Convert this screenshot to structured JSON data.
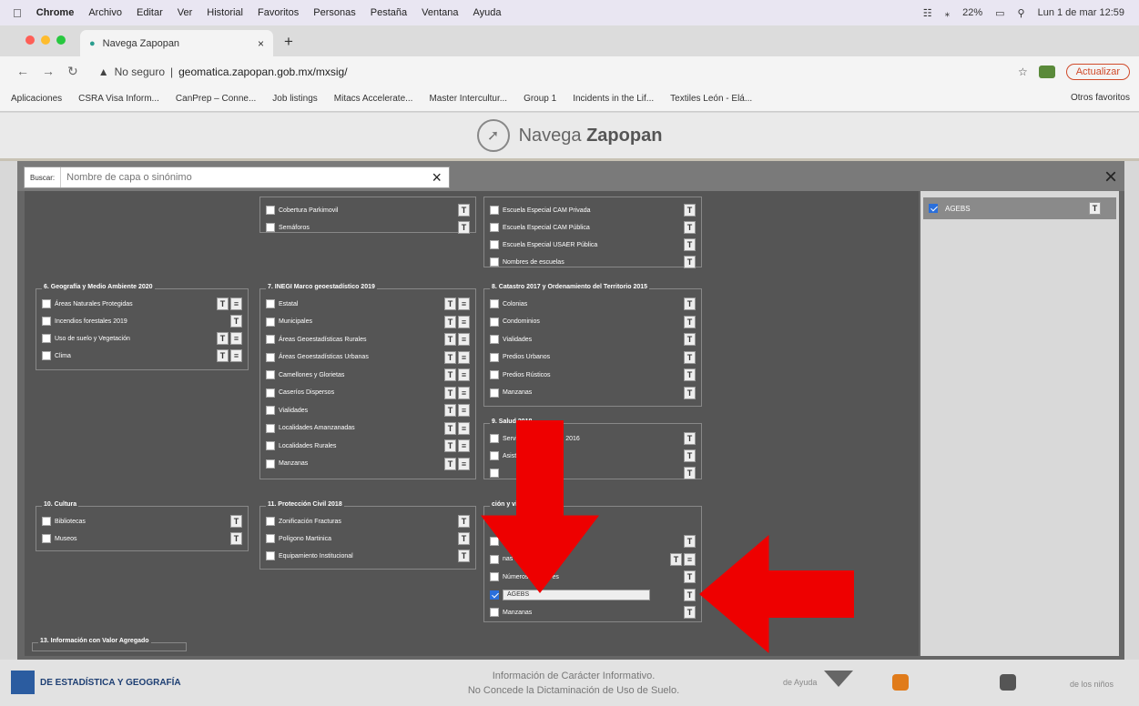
{
  "menubar": {
    "apple": "",
    "app": "Chrome",
    "items": [
      "Archivo",
      "Editar",
      "Ver",
      "Historial",
      "Favoritos",
      "Personas",
      "Pestaña",
      "Ventana",
      "Ayuda"
    ],
    "battery": "22%",
    "clock": "Lun 1 de mar 12:59"
  },
  "tab": {
    "title": "Navega Zapopan",
    "close": "×",
    "new": "+"
  },
  "address": {
    "secure": "No seguro",
    "url": "geomatica.zapopan.gob.mx/mxsig/",
    "update": "Actualizar"
  },
  "bookmarks": [
    "Aplicaciones",
    "CSRA Visa Inform...",
    "CanPrep – Conne...",
    "Job listings",
    "Mitacs Accelerate...",
    "Master Intercultur...",
    "Group 1",
    "Incidents in the Lif...",
    "Textiles León - Elá..."
  ],
  "bookmarks_other": "Otros favoritos",
  "site": {
    "title_a": "Navega ",
    "title_b": "Zapopan"
  },
  "search": {
    "label": "Buscar:",
    "placeholder": "Nombre de capa o sinónimo",
    "clear": "×",
    "close": "×"
  },
  "selected_panel": {
    "items": [
      {
        "label": "AGEBS",
        "checked": true
      }
    ]
  },
  "groups": [
    {
      "title": "",
      "items": [
        {
          "label": "Cobertura Parkimovil",
          "checked": false,
          "buttons": [
            "T"
          ]
        },
        {
          "label": "Semáforos",
          "checked": false,
          "buttons": [
            "T"
          ]
        }
      ]
    },
    {
      "title": "",
      "items": [
        {
          "label": "Escuela Especial CAM Privada",
          "checked": false,
          "buttons": [
            "T"
          ]
        },
        {
          "label": "Escuela Especial CAM Pública",
          "checked": false,
          "buttons": [
            "T"
          ]
        },
        {
          "label": "Escuela Especial USAER Pública",
          "checked": false,
          "buttons": [
            "T"
          ]
        },
        {
          "label": "Nombres de escuelas",
          "checked": false,
          "buttons": [
            "T"
          ]
        }
      ]
    },
    {
      "title": "6. Geografía y Medio Ambiente 2020",
      "items": [
        {
          "label": "Áreas Naturales Protegidas",
          "checked": false,
          "buttons": [
            "T",
            "D"
          ]
        },
        {
          "label": "Incendios forestales 2019",
          "checked": false,
          "buttons": [
            "T"
          ]
        },
        {
          "label": "Uso de suelo y Vegetación",
          "checked": false,
          "buttons": [
            "T",
            "D"
          ]
        },
        {
          "label": "Clima",
          "checked": false,
          "buttons": [
            "T",
            "D"
          ]
        }
      ]
    },
    {
      "title": "7. INEGI Marco geoestadístico 2019",
      "items": [
        {
          "label": "Estatal",
          "checked": false,
          "buttons": [
            "T",
            "D"
          ]
        },
        {
          "label": "Municipales",
          "checked": false,
          "buttons": [
            "T",
            "D"
          ]
        },
        {
          "label": "Áreas Geoestadísticas Rurales",
          "checked": false,
          "buttons": [
            "T",
            "D"
          ]
        },
        {
          "label": "Áreas Geoestadísticas Urbanas",
          "checked": false,
          "buttons": [
            "T",
            "D"
          ]
        },
        {
          "label": "Camellones y Glorietas",
          "checked": false,
          "buttons": [
            "T",
            "D"
          ]
        },
        {
          "label": "Caseríos Dispersos",
          "checked": false,
          "buttons": [
            "T",
            "D"
          ]
        },
        {
          "label": "Vialidades",
          "checked": false,
          "buttons": [
            "T",
            "D"
          ]
        },
        {
          "label": "Localidades Amanzanadas",
          "checked": false,
          "buttons": [
            "T",
            "D"
          ]
        },
        {
          "label": "Localidades Rurales",
          "checked": false,
          "buttons": [
            "T",
            "D"
          ]
        },
        {
          "label": "Manzanas",
          "checked": false,
          "buttons": [
            "T",
            "D"
          ]
        }
      ]
    },
    {
      "title": "8. Catastro 2017 y Ordenamiento del Territorio 2015",
      "items": [
        {
          "label": "Colonias",
          "checked": false,
          "buttons": [
            "T"
          ]
        },
        {
          "label": "Condominios",
          "checked": false,
          "buttons": [
            "T"
          ]
        },
        {
          "label": "Vialidades",
          "checked": false,
          "buttons": [
            "T"
          ]
        },
        {
          "label": "Predios Urbanos",
          "checked": false,
          "buttons": [
            "T"
          ]
        },
        {
          "label": "Predios Rústicos",
          "checked": false,
          "buttons": [
            "T"
          ]
        },
        {
          "label": "Manzanas",
          "checked": false,
          "buttons": [
            "T"
          ]
        }
      ]
    },
    {
      "title": "9. Salud 2018",
      "items": [
        {
          "label": "Servicios Municipales 2016",
          "checked": false,
          "buttons": [
            "T"
          ]
        },
        {
          "label": "Asistencia Médica",
          "checked": false,
          "buttons": [
            "T"
          ]
        },
        {
          "label": "",
          "checked": false,
          "buttons": [
            "T"
          ]
        }
      ]
    },
    {
      "title": "10. Cultura",
      "items": [
        {
          "label": "Bibliotecas",
          "checked": false,
          "buttons": [
            "T"
          ]
        },
        {
          "label": "Museos",
          "checked": false,
          "buttons": [
            "T"
          ]
        }
      ]
    },
    {
      "title": "11. Protección Civil 2018",
      "items": [
        {
          "label": "Zonificación Fracturas",
          "checked": false,
          "buttons": [
            "T"
          ]
        },
        {
          "label": "Polígono Martinica",
          "checked": false,
          "buttons": [
            "T"
          ]
        },
        {
          "label": "Equipamiento Institucional",
          "checked": false,
          "buttons": [
            "T"
          ]
        }
      ]
    },
    {
      "title": "ción y vivienda",
      "items": [
        {
          "label": "",
          "checked": false,
          "buttons": [
            "T"
          ]
        },
        {
          "label": "nas",
          "checked": false,
          "buttons": [
            "T",
            "D"
          ]
        },
        {
          "label": "Números Exteriores",
          "checked": false,
          "buttons": [
            "T"
          ]
        },
        {
          "label": "AGEBS",
          "checked": true,
          "buttons": [
            "T"
          ]
        },
        {
          "label": "Manzanas",
          "checked": false,
          "buttons": [
            "T"
          ]
        }
      ]
    },
    {
      "title": "13. Información con Valor Agregado",
      "items": []
    }
  ],
  "footer": {
    "inegi": "DE ESTADÍSTICA Y GEOGRAFÍA",
    "disclaimer_1": "Información de Carácter Informativo.",
    "disclaimer_2": "No Concede la Dictaminación de Uso de Suelo.",
    "ayuda": "de Ayuda",
    "ninos": "de los niños"
  }
}
